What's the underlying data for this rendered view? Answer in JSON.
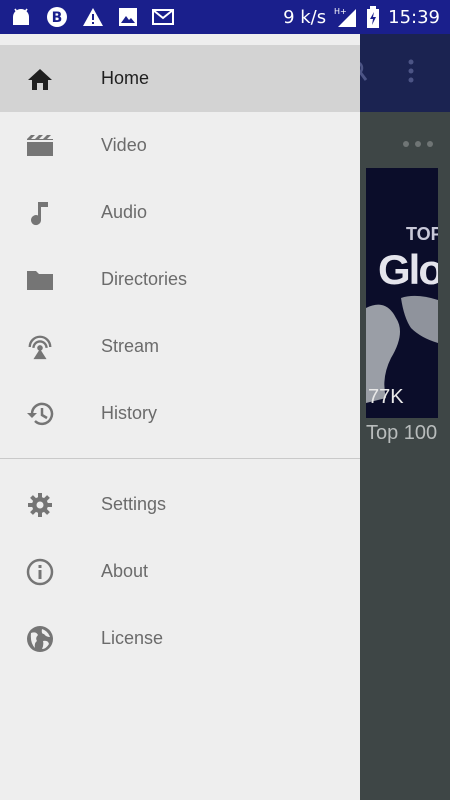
{
  "status_bar": {
    "icons_left": [
      "android-icon",
      "b-circle-icon",
      "warning-icon",
      "image-icon",
      "mail-icon"
    ],
    "speed": "9 k/s",
    "network": "H+",
    "time": "15:39"
  },
  "background": {
    "thumbnail_text_top": "TOP",
    "thumbnail_text_main": "Glo",
    "views": "77K",
    "caption": "Top 100"
  },
  "drawer": {
    "primary_items": [
      {
        "label": "Home",
        "icon": "home-icon",
        "active": true
      },
      {
        "label": "Video",
        "icon": "clapperboard-icon",
        "active": false
      },
      {
        "label": "Audio",
        "icon": "music-note-icon",
        "active": false
      },
      {
        "label": "Directories",
        "icon": "folder-icon",
        "active": false
      },
      {
        "label": "Stream",
        "icon": "antenna-icon",
        "active": false
      },
      {
        "label": "History",
        "icon": "history-icon",
        "active": false
      }
    ],
    "secondary_items": [
      {
        "label": "Settings",
        "icon": "gear-icon"
      },
      {
        "label": "About",
        "icon": "info-icon"
      },
      {
        "label": "License",
        "icon": "globe-icon"
      }
    ]
  },
  "colors": {
    "status_bar": "#1a1f8c",
    "drawer_bg": "#eeeeee",
    "active_item_bg": "#d3d3d3",
    "icon_gray": "#757575"
  }
}
